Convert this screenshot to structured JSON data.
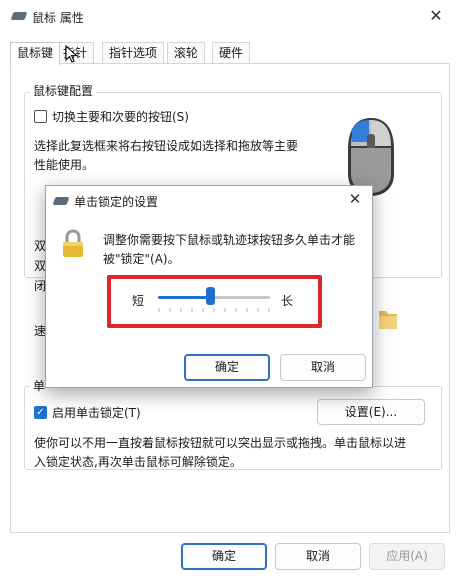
{
  "window": {
    "title": "鼠标 属性",
    "close_glyph": "✕"
  },
  "tabs": [
    {
      "label": "鼠标键",
      "active": true
    },
    {
      "label": "指针",
      "active": false
    },
    {
      "label": "指针选项",
      "active": false
    },
    {
      "label": "滚轮",
      "active": false
    },
    {
      "label": "硬件",
      "active": false
    }
  ],
  "button_config": {
    "legend": "鼠标键配置",
    "swap_label": "切换主要和次要的按钮(S)",
    "swap_checked": false,
    "desc_line1": "选择此复选框来将右按钮设成如选择和拖放等主要",
    "desc_line2": "性能使用。"
  },
  "dblclick_fragments": {
    "line1": "双",
    "line2": "双",
    "line3": "闭",
    "speed": "速"
  },
  "clicklock": {
    "legend": "单",
    "enable_label": "启用单击锁定(T)",
    "enable_checked": true,
    "settings_button": "设置(E)...",
    "desc_line1": "使你可以不用一直按着鼠标按钮就可以突出显示或拖拽。单击鼠标以进",
    "desc_line2": "入锁定状态,再次单击鼠标可解除锁定。"
  },
  "dialog": {
    "title": "单击锁定的设置",
    "close_glyph": "✕",
    "desc_line1": "调整你需要按下鼠标或轨迹球按钮多久单击才能",
    "desc_line2": "被\"锁定\"(A)。",
    "slider_short": "短",
    "slider_long": "长",
    "slider_value_fraction": 0.47,
    "ok": "确定",
    "cancel": "取消"
  },
  "footer": {
    "ok": "确定",
    "cancel": "取消",
    "apply": "应用(A)"
  },
  "colors": {
    "accent": "#1f6fd1",
    "highlight_box": "#e0262b"
  }
}
